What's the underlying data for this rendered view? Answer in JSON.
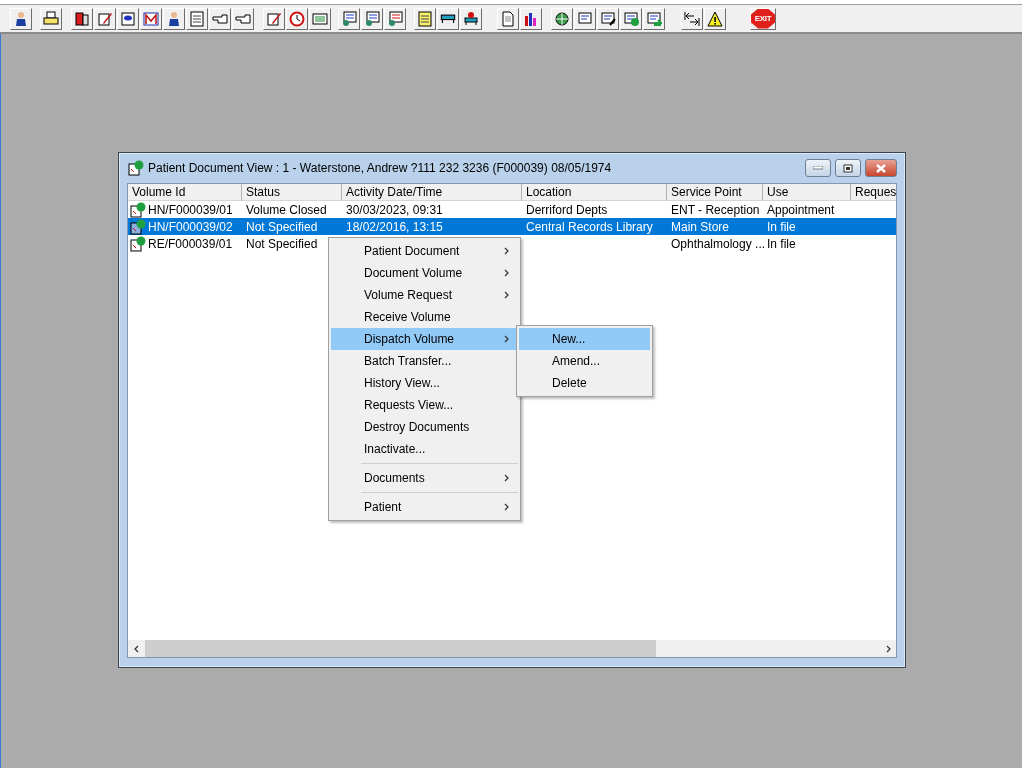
{
  "toolbar": {
    "exit_label": "EXIT"
  },
  "window": {
    "title": "Patient Document View : 1 - Waterstone, Andrew ?111 232 3236 (F000039) 08/05/1974"
  },
  "table": {
    "columns": [
      "Volume Id",
      "Status",
      "Activity Date/Time",
      "Location",
      "Service Point",
      "Use",
      "Reques"
    ],
    "rows": [
      {
        "selected": false,
        "cells": [
          "HN/F000039/01",
          "Volume Closed",
          "30/03/2023, 09:31",
          "Derriford Depts",
          "ENT - Reception",
          "Appointment"
        ]
      },
      {
        "selected": true,
        "cells": [
          "HN/F000039/02",
          "Not Specified",
          "18/02/2016, 13:15",
          "Central Records Library",
          "Main Store",
          "In file"
        ]
      },
      {
        "selected": false,
        "cells": [
          "RE/F000039/01",
          "Not Specified",
          "",
          "",
          "Ophthalmology ...",
          "In file"
        ]
      }
    ]
  },
  "context_menu": {
    "items": [
      {
        "kind": "item",
        "label": "Patient Document",
        "has_submenu": true,
        "selected": false
      },
      {
        "kind": "item",
        "label": "Document Volume",
        "has_submenu": true,
        "selected": false
      },
      {
        "kind": "item",
        "label": "Volume Request",
        "has_submenu": true,
        "selected": false
      },
      {
        "kind": "item",
        "label": "Receive Volume",
        "has_submenu": false,
        "selected": false
      },
      {
        "kind": "item",
        "label": "Dispatch Volume",
        "has_submenu": true,
        "selected": true,
        "submenu": [
          {
            "label": "New...",
            "selected": true
          },
          {
            "label": "Amend...",
            "selected": false
          },
          {
            "label": "Delete",
            "selected": false
          }
        ]
      },
      {
        "kind": "item",
        "label": "Batch Transfer...",
        "has_submenu": false,
        "selected": false
      },
      {
        "kind": "item",
        "label": "History View...",
        "has_submenu": false,
        "selected": false
      },
      {
        "kind": "item",
        "label": "Requests View...",
        "has_submenu": false,
        "selected": false
      },
      {
        "kind": "item",
        "label": "Destroy Documents",
        "has_submenu": false,
        "selected": false
      },
      {
        "kind": "item",
        "label": "Inactivate...",
        "has_submenu": false,
        "selected": false
      },
      {
        "kind": "separator"
      },
      {
        "kind": "item",
        "label": "Documents",
        "has_submenu": true,
        "selected": false
      },
      {
        "kind": "separator"
      },
      {
        "kind": "item",
        "label": "Patient",
        "has_submenu": true,
        "selected": false
      }
    ]
  }
}
